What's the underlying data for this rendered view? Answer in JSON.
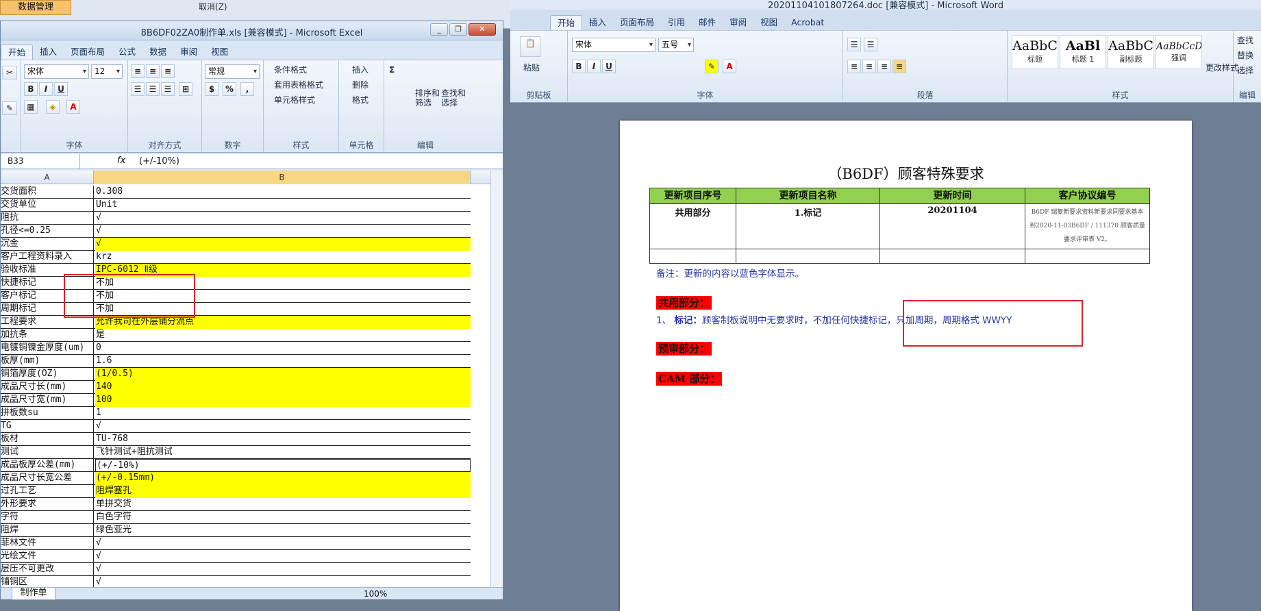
{
  "background": {
    "tab": "数据管理",
    "cancel": "取消(Z)"
  },
  "excel": {
    "title": "8B6DF02ZA0制作单.xls  [兼容模式] - Microsoft Excel",
    "tabs": [
      "开始",
      "插入",
      "页面布局",
      "公式",
      "数据",
      "审阅",
      "视图"
    ],
    "font_name": "宋体",
    "font_size": "12",
    "number_format": "常规",
    "groups": {
      "font": "字体",
      "align": "对齐方式",
      "number": "数字",
      "styles": "样式",
      "cells": "单元格",
      "edit": "编辑"
    },
    "styles_btns": [
      "条件格式",
      "套用表格格式",
      "单元格样式"
    ],
    "cells_btns": [
      "插入",
      "删除",
      "格式"
    ],
    "edit_btns": [
      "排序和\n筛选",
      "查找和\n选择"
    ],
    "namebox": "B33",
    "fx": "fx",
    "formula": "(+/-10%)",
    "col_a": "A",
    "col_b": "B",
    "rows": [
      {
        "a": "交货面积",
        "b": "0.308",
        "y": false
      },
      {
        "a": "交货单位",
        "b": "Unit",
        "y": false
      },
      {
        "a": "阻抗",
        "b": "√",
        "y": false
      },
      {
        "a": "孔径<=0.25",
        "b": "√",
        "y": false
      },
      {
        "a": "沉金",
        "b": "√",
        "y": true
      },
      {
        "a": "客户工程资料录入",
        "b": "krz",
        "y": false
      },
      {
        "a": "验收标准",
        "b": "IPC-6012 Ⅱ级",
        "y": true
      },
      {
        "a": "快捷标记",
        "b": "不加",
        "y": false
      },
      {
        "a": "客户标记",
        "b": "不加",
        "y": false
      },
      {
        "a": "周期标记",
        "b": "不加",
        "y": false
      },
      {
        "a": "工程要求",
        "b": "允许我司在外层铺分流点",
        "y": true
      },
      {
        "a": "加抗条",
        "b": "是",
        "y": false
      },
      {
        "a": "电镀铜镍金厚度(um)",
        "b": "0",
        "y": false
      },
      {
        "a": "板厚(mm)",
        "b": "1.6",
        "y": false
      },
      {
        "a": "铜箔厚度(OZ)",
        "b": "(1/0.5)",
        "y": true
      },
      {
        "a": "成品尺寸长(mm)",
        "b": "140",
        "y": true
      },
      {
        "a": "成品尺寸宽(mm)",
        "b": "100",
        "y": true
      },
      {
        "a": "拼板数su",
        "b": "1",
        "y": false
      },
      {
        "a": "TG",
        "b": "√",
        "y": false
      },
      {
        "a": "板材",
        "b": "TU-768",
        "y": false
      },
      {
        "a": "测试",
        "b": "飞针测试+阻抗测试",
        "y": false
      },
      {
        "a": "成品板厚公差(mm)",
        "b": "(+/-10%)",
        "y": false,
        "sel": true
      },
      {
        "a": "成品尺寸长宽公差",
        "b": "(+/-0.15mm)",
        "y": true
      },
      {
        "a": "过孔工艺",
        "b": "阻焊塞孔",
        "y": true
      },
      {
        "a": "外形要求",
        "b": "单拼交货",
        "y": false
      },
      {
        "a": "字符",
        "b": "白色字符",
        "y": false
      },
      {
        "a": "阻焊",
        "b": "绿色亚光",
        "y": false
      },
      {
        "a": "菲林文件",
        "b": "√",
        "y": false
      },
      {
        "a": "光绘文件",
        "b": "√",
        "y": false
      },
      {
        "a": "层压不可更改",
        "b": "√",
        "y": false
      },
      {
        "a": "铺铜区",
        "b": "√",
        "y": false
      }
    ],
    "sheet_tab": "制作单",
    "zoom": "100%"
  },
  "word": {
    "title": "20201104101807264.doc [兼容模式] - Microsoft Word",
    "tabs": [
      "开始",
      "插入",
      "页面布局",
      "引用",
      "邮件",
      "审阅",
      "视图",
      "Acrobat"
    ],
    "font_name": "宋体",
    "font_size": "五号",
    "groups": {
      "clipboard": "剪贴板",
      "font": "字体",
      "para": "段落",
      "styles": "样式",
      "edit": "编辑"
    },
    "paste": "粘贴",
    "styles": [
      {
        "sample": "AaBbC",
        "name": "标题"
      },
      {
        "sample": "AaBl",
        "name": "标题 1"
      },
      {
        "sample": "AaBbC",
        "name": "副标题"
      },
      {
        "sample": "AaBbCcD",
        "name": "强调"
      }
    ],
    "change_styles": "更改样式",
    "edit_btns": [
      "查找",
      "替换",
      "选择"
    ],
    "doc_title": "（B6DF）顾客特殊要求",
    "table_headers": [
      "更新项目序号",
      "更新项目名称",
      "更新时间",
      "客户协议编号"
    ],
    "table_row": [
      "共用部分",
      "1.标记",
      "20201104",
      "B6DF 瑞复新要求资料新要求同要求基本到2020-11-03B6DF / 111370 顾客质量要求评审表 V2。"
    ],
    "note": "备注：更新的内容以蓝色字体显示。",
    "sec1": "共用部分：",
    "item1_num": "1、",
    "item1_label": "标记：",
    "item1_text": "顾客制板说明中无要求时，不加任何快捷标记，只加周期，周期格式 WWYY",
    "sec2": "预审部分：",
    "sec3": "CAM 部分："
  }
}
